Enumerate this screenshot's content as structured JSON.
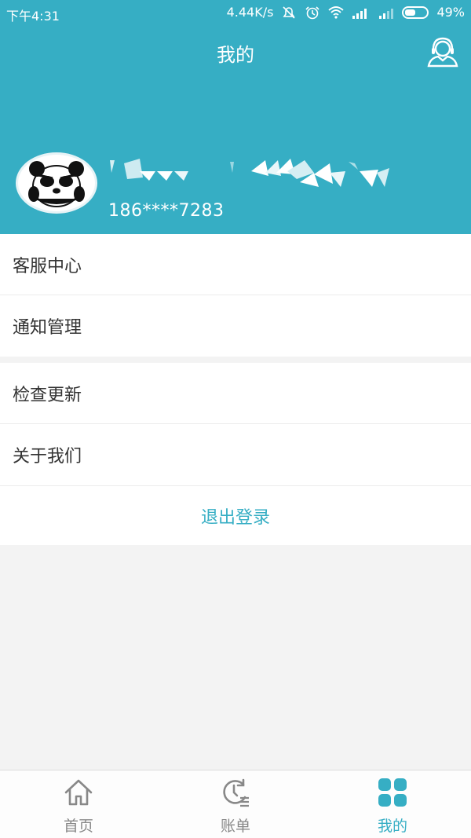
{
  "status_bar": {
    "time": "下午4:31",
    "network_speed": "4.44K/s",
    "battery": "49%",
    "battery_level": 0.49
  },
  "header": {
    "title": "我的",
    "bg_color": "#36aec4"
  },
  "profile": {
    "phone": "186****7283"
  },
  "menu_group_1": [
    {
      "label": "客服中心"
    },
    {
      "label": "通知管理"
    }
  ],
  "menu_group_2": [
    {
      "label": "检查更新"
    },
    {
      "label": "关于我们"
    }
  ],
  "logout_label": "退出登录",
  "tabs": [
    {
      "label": "首页",
      "icon": "home-icon",
      "active": false
    },
    {
      "label": "账单",
      "icon": "bill-history-icon",
      "active": false
    },
    {
      "label": "我的",
      "icon": "grid-icon",
      "active": true
    }
  ],
  "colors": {
    "accent": "#36aec4",
    "background": "#f3f3f3"
  }
}
